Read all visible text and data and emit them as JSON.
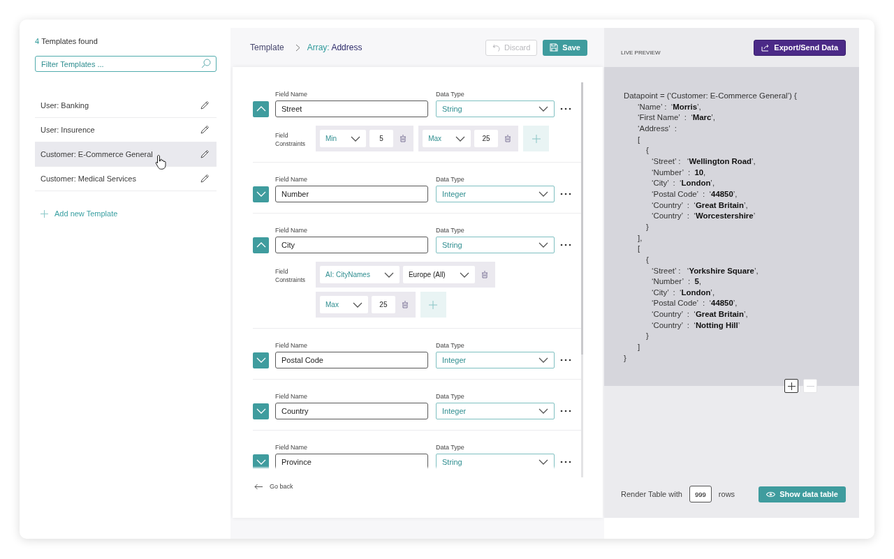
{
  "sidebar": {
    "results": {
      "count": "4",
      "label": "Templates found"
    },
    "filter": {
      "placeholder": "Filter Templates ..."
    },
    "templates": [
      {
        "label": "User: Banking",
        "selected": false
      },
      {
        "label": "User: Insurence",
        "selected": false
      },
      {
        "label": "Customer: E-Commerce General",
        "selected": true
      },
      {
        "label": "Customer: Medical Services",
        "selected": false
      }
    ],
    "add_link": "Add new Template"
  },
  "editor": {
    "breadcrumb": {
      "root": "Template",
      "current_prefix": "Array:",
      "current": "Address"
    },
    "buttons": [
      {
        "kind": "discard",
        "label": "Discard",
        "disabled": true
      },
      {
        "kind": "save",
        "label": "Save",
        "disabled": false
      }
    ],
    "fields": [
      {
        "name_label": "Field Name",
        "type_label": "Data Type",
        "name": "Street",
        "data_type": "String",
        "expanded": true,
        "constraints_label": "Field Constraints",
        "constraints": [
          [
            {
              "kind": "select",
              "value": "Min"
            },
            {
              "kind": "number",
              "value": "5"
            }
          ],
          [
            {
              "kind": "select",
              "value": "Max"
            },
            {
              "kind": "number",
              "value": "25"
            }
          ]
        ]
      },
      {
        "name_label": "Field Name",
        "type_label": "Data Type",
        "name": "Number",
        "data_type": "Integer",
        "expanded": false
      },
      {
        "name_label": "Field Name",
        "type_label": "Data Type",
        "name": "City",
        "data_type": "String",
        "expanded": true,
        "constraints_label": "Field Constraints",
        "constraints": [
          [
            {
              "kind": "select",
              "value": "AI: CityNames"
            },
            {
              "kind": "option",
              "value": "Europe (All)"
            }
          ],
          [
            {
              "kind": "select",
              "value": "Max"
            },
            {
              "kind": "number",
              "value": "25"
            }
          ]
        ]
      },
      {
        "name_label": "Field Name",
        "type_label": "Data Type",
        "name": "Postal Code",
        "data_type": "Integer",
        "expanded": false
      },
      {
        "name_label": "Field Name",
        "type_label": "Data Type",
        "name": "Country",
        "data_type": "Integer",
        "expanded": false
      },
      {
        "name_label": "Field Name",
        "type_label": "Data Type",
        "name": "Province",
        "data_type": "String",
        "expanded": false
      }
    ],
    "back_link": "Go back"
  },
  "preview": {
    "title": "LIVE PREVIEW",
    "export_button": "Export/Send Data",
    "code": {
      "text": "Datapoint = (‘Customer: E-Commerce General’) {",
      "close": "}",
      "children": [
        {
          "text": "‘Name’ :  ‘**Morris**’,"
        },
        {
          "text": "‘First Name’  :  ‘**Marc**’,"
        },
        {
          "text": "‘Address’  :"
        },
        {
          "text": "[",
          "close": "],",
          "children": [
            {
              "text": "{",
              "close": "}",
              "children": [
                {
                  "text": "‘Street’ :   ‘**Wellington Road**’,"
                },
                {
                  "text": "‘Number’  :  **10**,"
                },
                {
                  "text": "‘City’  :  ‘**London**’,"
                },
                {
                  "text": "‘Postal Code’  :  ‘**44850**’,"
                },
                {
                  "text": "‘Country’  :  ‘**Great Britain**’,"
                },
                {
                  "text": "‘Country’  :  ‘**Worcestershire**’"
                }
              ]
            }
          ]
        },
        {
          "text": "[",
          "close": "]",
          "children": [
            {
              "text": "{",
              "close": "}",
              "children": [
                {
                  "text": "‘Street’ :   ‘**Yorkshire Square**’,"
                },
                {
                  "text": "‘Number’  :  **5**,"
                },
                {
                  "text": "‘City’  :  ‘**London**’,"
                },
                {
                  "text": "‘Postal Code’  :  ‘**44850**’,"
                },
                {
                  "text": "‘Country’  :  ‘**Great Britain**’,"
                },
                {
                  "text": "‘Country’  :  ‘**Notting Hill**’"
                }
              ]
            }
          ]
        }
      ]
    },
    "zoom": [
      {
        "kind": "plus",
        "disabled": false
      },
      {
        "kind": "minus",
        "disabled": true
      }
    ],
    "render": {
      "label": "Render Table with",
      "value": "999",
      "suffix": "rows"
    },
    "show_button": "Show data table"
  }
}
